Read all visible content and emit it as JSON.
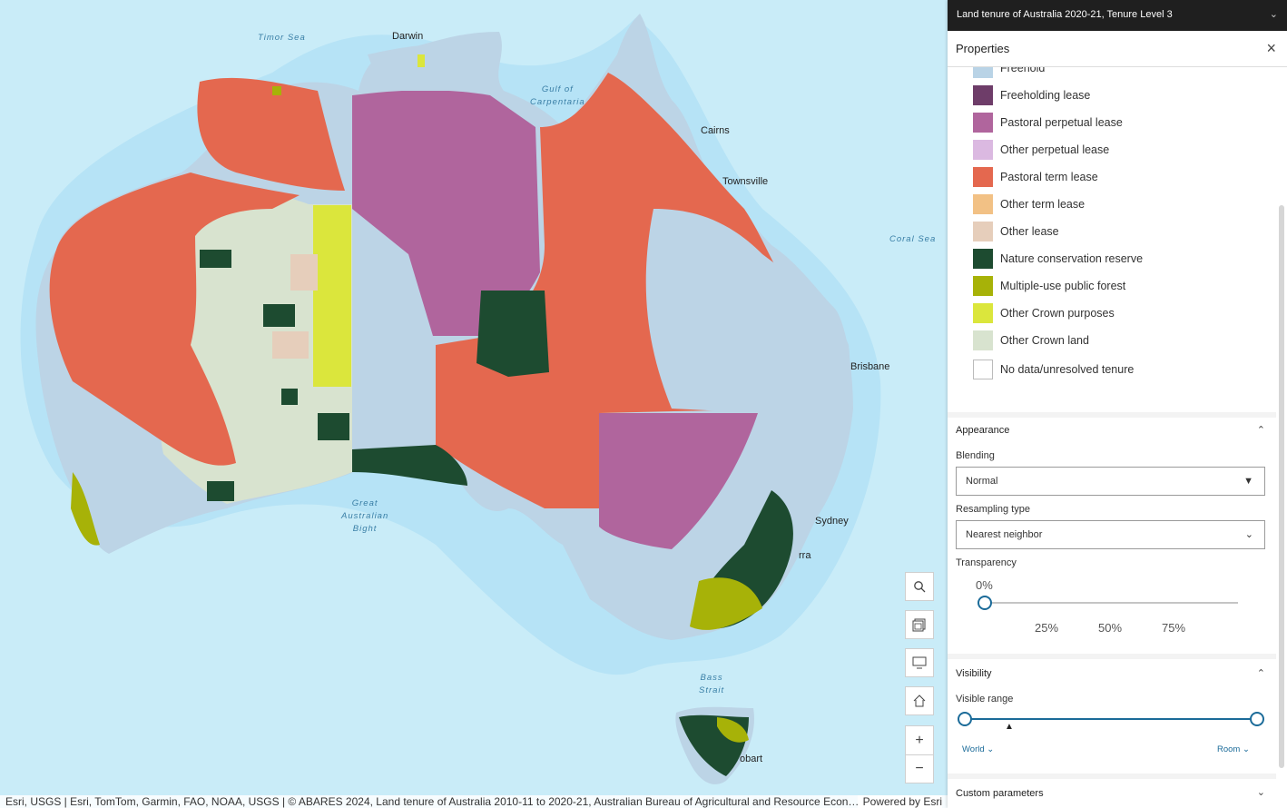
{
  "map": {
    "cities": [
      "Darwin",
      "Cairns",
      "Townsville",
      "Brisbane",
      "Sydney",
      "rra",
      "obart"
    ],
    "seas": [
      "Timor Sea",
      "Gulf of\nCarpentaria",
      "Coral Sea",
      "Great\nAustralian\nBight",
      "Bass\nStrait"
    ],
    "tools": {
      "search": "search-icon",
      "basemap": "basemap-gallery-icon",
      "screen": "screen-icon",
      "home": "home-icon",
      "zoom_in": "+",
      "zoom_out": "−"
    },
    "attribution": "Esri, USGS | Esri, TomTom, Garmin, FAO, NOAA, USGS | © ABARES 2024, Land tenure of Australia 2010-11 to 2020-21, Australian Bureau of Agricultural and Resource Econ…",
    "powered_by": "Powered by Esri"
  },
  "panel": {
    "title": "Land tenure of Australia 2020-21, Tenure Level 3",
    "header": "Properties",
    "legend": [
      {
        "label": "Freehold",
        "color": "#b9d3e6"
      },
      {
        "label": "Freeholding lease",
        "color": "#6e3d69"
      },
      {
        "label": "Pastoral perpetual lease",
        "color": "#b0659d"
      },
      {
        "label": "Other perpetual lease",
        "color": "#dbb9e1"
      },
      {
        "label": "Pastoral term lease",
        "color": "#e4684f"
      },
      {
        "label": "Other term lease",
        "color": "#f2c185"
      },
      {
        "label": "Other lease",
        "color": "#e6cebb"
      },
      {
        "label": "Nature conservation reserve",
        "color": "#1d4b30"
      },
      {
        "label": "Multiple-use public forest",
        "color": "#a7b208"
      },
      {
        "label": "Other Crown purposes",
        "color": "#dbe63c"
      },
      {
        "label": "Other Crown land",
        "color": "#d8e3cf"
      },
      {
        "label": "No data/unresolved tenure",
        "color": "#ffffff"
      }
    ],
    "appearance": {
      "heading": "Appearance",
      "blending_label": "Blending",
      "blending_value": "Normal",
      "resampling_label": "Resampling type",
      "resampling_value": "Nearest neighbor",
      "transparency_label": "Transparency",
      "transparency_value": "0%",
      "ticks": [
        "25%",
        "50%",
        "75%"
      ]
    },
    "visibility": {
      "heading": "Visibility",
      "range_label": "Visible range",
      "min_label": "World",
      "max_label": "Room"
    },
    "custom_heading": "Custom parameters"
  }
}
